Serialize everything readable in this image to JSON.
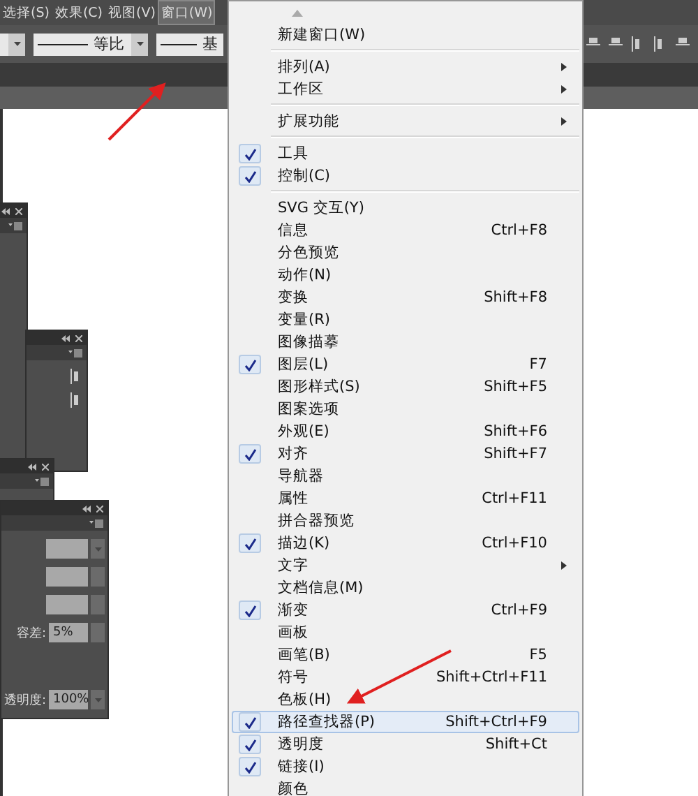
{
  "menubar": [
    {
      "label": "选择(S)",
      "selected": false
    },
    {
      "label": "效果(C)",
      "selected": false
    },
    {
      "label": "视图(V)",
      "selected": false
    },
    {
      "label": "窗口(W)",
      "selected": true
    }
  ],
  "control_bar": {
    "profile_dropdown": {
      "value": "等比"
    },
    "brush_dropdown": {
      "value": "基"
    }
  },
  "panels": {
    "tolerance": {
      "label": "容差:",
      "value": "5%"
    },
    "opacity": {
      "label": "透明度:",
      "value": "100%"
    }
  },
  "menu": [
    {
      "kind": "scroll"
    },
    {
      "kind": "item",
      "label": "新建窗口(W)",
      "checked": false,
      "submenu": false,
      "selected": false
    },
    {
      "kind": "separator"
    },
    {
      "kind": "item",
      "label": "排列(A)",
      "checked": false,
      "submenu": true,
      "selected": false
    },
    {
      "kind": "item",
      "label": "工作区",
      "checked": false,
      "submenu": true,
      "selected": false
    },
    {
      "kind": "separator"
    },
    {
      "kind": "item",
      "label": "扩展功能",
      "checked": false,
      "submenu": true,
      "selected": false
    },
    {
      "kind": "separator"
    },
    {
      "kind": "item",
      "label": "工具",
      "checked": true,
      "submenu": false,
      "selected": false
    },
    {
      "kind": "item",
      "label": "控制(C)",
      "checked": true,
      "submenu": false,
      "selected": false
    },
    {
      "kind": "separator"
    },
    {
      "kind": "item",
      "label": "SVG 交互(Y)",
      "checked": false,
      "submenu": false,
      "selected": false
    },
    {
      "kind": "item",
      "label": "信息",
      "shortcut": "Ctrl+F8",
      "checked": false,
      "submenu": false,
      "selected": false
    },
    {
      "kind": "item",
      "label": "分色预览",
      "checked": false,
      "submenu": false,
      "selected": false
    },
    {
      "kind": "item",
      "label": "动作(N)",
      "checked": false,
      "submenu": false,
      "selected": false
    },
    {
      "kind": "item",
      "label": "变换",
      "shortcut": "Shift+F8",
      "checked": false,
      "submenu": false,
      "selected": false
    },
    {
      "kind": "item",
      "label": "变量(R)",
      "checked": false,
      "submenu": false,
      "selected": false
    },
    {
      "kind": "item",
      "label": "图像描摹",
      "checked": false,
      "submenu": false,
      "selected": false
    },
    {
      "kind": "item",
      "label": "图层(L)",
      "shortcut": "F7",
      "checked": true,
      "submenu": false,
      "selected": false
    },
    {
      "kind": "item",
      "label": "图形样式(S)",
      "shortcut": "Shift+F5",
      "checked": false,
      "submenu": false,
      "selected": false
    },
    {
      "kind": "item",
      "label": "图案选项",
      "checked": false,
      "submenu": false,
      "selected": false
    },
    {
      "kind": "item",
      "label": "外观(E)",
      "shortcut": "Shift+F6",
      "checked": false,
      "submenu": false,
      "selected": false
    },
    {
      "kind": "item",
      "label": "对齐",
      "shortcut": "Shift+F7",
      "checked": true,
      "submenu": false,
      "selected": false
    },
    {
      "kind": "item",
      "label": "导航器",
      "checked": false,
      "submenu": false,
      "selected": false
    },
    {
      "kind": "item",
      "label": "属性",
      "shortcut": "Ctrl+F11",
      "checked": false,
      "submenu": false,
      "selected": false
    },
    {
      "kind": "item",
      "label": "拼合器预览",
      "checked": false,
      "submenu": false,
      "selected": false
    },
    {
      "kind": "item",
      "label": "描边(K)",
      "shortcut": "Ctrl+F10",
      "checked": true,
      "submenu": false,
      "selected": false
    },
    {
      "kind": "item",
      "label": "文字",
      "checked": false,
      "submenu": true,
      "selected": false
    },
    {
      "kind": "item",
      "label": "文档信息(M)",
      "checked": false,
      "submenu": false,
      "selected": false
    },
    {
      "kind": "item",
      "label": "渐变",
      "shortcut": "Ctrl+F9",
      "checked": true,
      "submenu": false,
      "selected": false
    },
    {
      "kind": "item",
      "label": "画板",
      "checked": false,
      "submenu": false,
      "selected": false
    },
    {
      "kind": "item",
      "label": "画笔(B)",
      "shortcut": "F5",
      "checked": false,
      "submenu": false,
      "selected": false
    },
    {
      "kind": "item",
      "label": "符号",
      "shortcut": "Shift+Ctrl+F11",
      "checked": false,
      "submenu": false,
      "selected": false
    },
    {
      "kind": "item",
      "label": "色板(H)",
      "checked": false,
      "submenu": false,
      "selected": false
    },
    {
      "kind": "item",
      "label": "路径查找器(P)",
      "shortcut": "Shift+Ctrl+F9",
      "checked": true,
      "submenu": false,
      "selected": true
    },
    {
      "kind": "item",
      "label": "透明度",
      "shortcut": "Shift+Ct",
      "checked": true,
      "submenu": false,
      "selected": false
    },
    {
      "kind": "item",
      "label": "链接(I)",
      "checked": true,
      "submenu": false,
      "selected": false
    },
    {
      "kind": "item",
      "label": "颜色",
      "checked": false,
      "submenu": false,
      "selected": false
    }
  ]
}
